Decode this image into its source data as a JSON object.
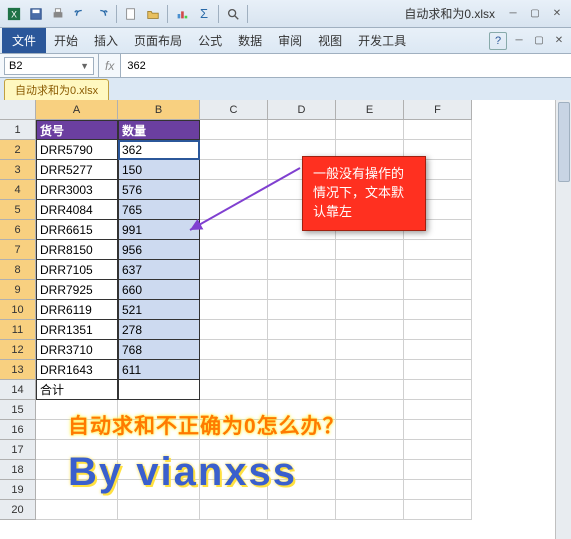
{
  "title_filename": "自动求和为0.xlsx",
  "ribbon": {
    "file": "文件",
    "tabs": [
      "开始",
      "插入",
      "页面布局",
      "公式",
      "数据",
      "审阅",
      "视图",
      "开发工具"
    ]
  },
  "namebox": "B2",
  "formula": "362",
  "workbook_tab": "自动求和为0.xlsx",
  "columns": [
    "A",
    "B",
    "C",
    "D",
    "E",
    "F"
  ],
  "header_row": {
    "a": "货号",
    "b": "数量"
  },
  "rows": [
    {
      "n": 1
    },
    {
      "n": 2,
      "a": "DRR5790",
      "b": "362"
    },
    {
      "n": 3,
      "a": "DRR5277",
      "b": "150"
    },
    {
      "n": 4,
      "a": "DRR3003",
      "b": "576"
    },
    {
      "n": 5,
      "a": "DRR4084",
      "b": "765"
    },
    {
      "n": 6,
      "a": "DRR6615",
      "b": "991"
    },
    {
      "n": 7,
      "a": "DRR8150",
      "b": "956"
    },
    {
      "n": 8,
      "a": "DRR7105",
      "b": "637"
    },
    {
      "n": 9,
      "a": "DRR7925",
      "b": "660"
    },
    {
      "n": 10,
      "a": "DRR6119",
      "b": "521"
    },
    {
      "n": 11,
      "a": "DRR1351",
      "b": "278"
    },
    {
      "n": 12,
      "a": "DRR3710",
      "b": "768"
    },
    {
      "n": 13,
      "a": "DRR1643",
      "b": "611"
    },
    {
      "n": 14,
      "a": "合计",
      "b": ""
    },
    {
      "n": 15
    },
    {
      "n": 16
    },
    {
      "n": 17
    },
    {
      "n": 18
    },
    {
      "n": 19
    },
    {
      "n": 20
    }
  ],
  "callout_text": "一般没有操作的情况下，文本默认靠左",
  "anno1_text": "自动求和不正确为0怎么办？",
  "anno2_text": "By  vianxss",
  "qat_sigma": "Σ",
  "fx_label": "fx"
}
